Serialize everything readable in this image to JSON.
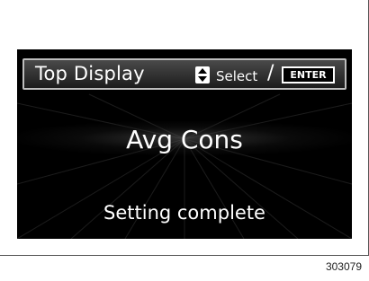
{
  "screen": {
    "header": {
      "title": "Top Display",
      "select_label": "Select",
      "separator": "/",
      "enter_label": "ENTER",
      "updown_icon": "up-down-arrows-icon"
    },
    "main_value": "Avg Cons",
    "status": "Setting complete"
  },
  "figure_id": "303079",
  "colors": {
    "screen_background": "#000000",
    "text": "#ffffff",
    "header_border": "#bdbdbd"
  }
}
